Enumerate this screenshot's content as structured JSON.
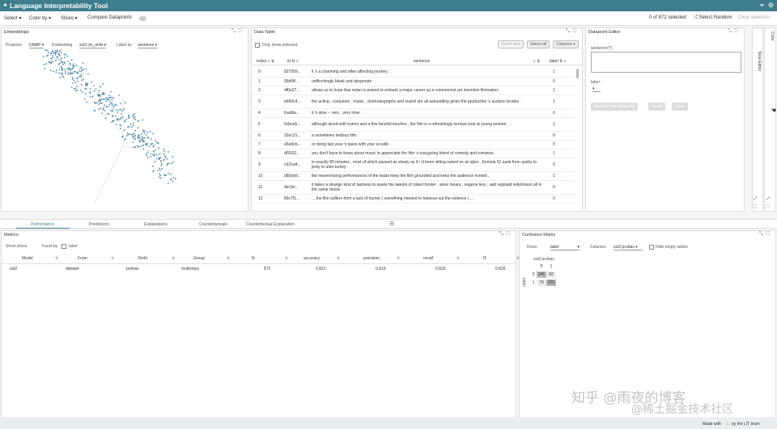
{
  "app": {
    "title": "Language Interpretability Tool"
  },
  "toolbar": {
    "select": "Select",
    "color_by": "Color by",
    "slices": "Slices",
    "compare": "Compare Datapoints",
    "selected_count": "0 of 872 selected",
    "select_random": "Select Random",
    "clear_selection": "Clear selection"
  },
  "embeddings": {
    "title": "Embeddings",
    "projector_label": "Projector",
    "projector_value": "UMAP",
    "embedding_label": "Embedding",
    "embedding_value": "sst2:cls_emb",
    "labelby_label": "Label by",
    "labelby_value": "sentence"
  },
  "datatable": {
    "title": "Data Table",
    "only_selected": "Only show selected",
    "reset_view": "Reset view",
    "select_all": "Select all",
    "columns": "Columns",
    "headers": {
      "index": "Index",
      "id": "id",
      "sentence": "sentence",
      "label": "label"
    },
    "rows": [
      {
        "index": "0",
        "id": "827559...",
        "sentence": "it 's a charming and often affecting journey .",
        "label": "1"
      },
      {
        "index": "1",
        "id": "96d0ff...",
        "sentence": "unflinchingly bleak and desperate",
        "label": "0"
      },
      {
        "index": "2",
        "id": "df0e27...",
        "sentence": "allows us to hope that nolan is poised to embark a major career as a commercial yet inventive filmmaker .",
        "label": "1"
      },
      {
        "index": "3",
        "id": "eb90c4...",
        "sentence": "the acting , costumes , music , cinematography and sound are all astounding given the production 's austere locales .",
        "label": "1"
      },
      {
        "index": "4",
        "id": "fcedba...",
        "sentence": "it 's slow -- very , very slow .",
        "label": "0"
      },
      {
        "index": "5",
        "id": "5cbca5...",
        "sentence": "although laced with humor and a few fanciful touches , the film is a refreshingly serious look at young women .",
        "label": "1"
      },
      {
        "index": "6",
        "id": "32ec21...",
        "sentence": "a sometimes tedious film .",
        "label": "0"
      },
      {
        "index": "7",
        "id": "a5a9cb...",
        "sentence": "or doing last year 's taxes with your ex-wife .",
        "label": "0"
      },
      {
        "index": "8",
        "id": "df3932...",
        "sentence": "you don't have to know about music to appreciate the film 's easygoing blend of comedy and romance .",
        "label": "1"
      },
      {
        "index": "9",
        "id": "cb31a4...",
        "sentence": "in exactly 89 minutes , most of which passed as slowly as if i 'd been sitting naked on an igloo , formula 51 sank from quirky to jerky to utter turkey .",
        "label": "0"
      },
      {
        "index": "10",
        "id": "d60a0d...",
        "sentence": "the mesmerizing performances of the leads keep the film grounded and keep the audience riveted .",
        "label": "1"
      },
      {
        "index": "11",
        "id": "dec9e...",
        "sentence": "it takes a strange kind of laziness to waste the talents of robert forster , anne meara , eugene levy , and reginald veljohnson all in the same movie .",
        "label": "0"
      },
      {
        "index": "12",
        "id": "89c7f1...",
        "sentence": "... the film suffers from a lack of humor ( something needed to balance out the violence ) ...",
        "label": "0"
      }
    ]
  },
  "datapoint_editor": {
    "title": "Datapoint Editor",
    "sentence_label": "sentence(*):",
    "label_label": "label:",
    "analyze_button": "Analyze new datapoint",
    "reset_button": "Reset",
    "clear_button": "Clear"
  },
  "side": {
    "slice_editor": "Slice Editor",
    "color": "Color"
  },
  "tabs": [
    "Performance",
    "Predictions",
    "Explanations",
    "Counterfactuals",
    "Counterfactual Explanation"
  ],
  "metrics": {
    "title": "Metrics",
    "show_slices": "Show slices",
    "facet_by": "Facet by",
    "facet_label": "label",
    "headers": [
      "Model",
      "From",
      "Field",
      "Group",
      "N",
      "accuracy",
      "precision",
      "recall",
      "f1"
    ],
    "row": [
      "sst2",
      "dataset",
      "probas",
      "multiclass",
      "872",
      "0.821",
      "0.819",
      "0.833",
      "0.826"
    ]
  },
  "confusion": {
    "title": "Confusion Matrix",
    "rows_label": "Rows",
    "rows_value": "label",
    "columns_label": "Columns",
    "columns_value": "sst2:probas",
    "hide_empty": "Hide empty labels",
    "col_title": "sst2:probas",
    "row_title": "label",
    "col_headers": [
      "0",
      "1"
    ],
    "row_headers": [
      "0",
      "1"
    ],
    "cells": [
      [
        "346",
        "82"
      ],
      [
        "74",
        "370"
      ]
    ]
  },
  "footer": {
    "made_with": "Made with",
    "by": "by the LIT team"
  },
  "watermark": {
    "text1": "知乎 @雨夜的博客",
    "text2": "@稀土掘金技术社区"
  },
  "colors": {
    "header": "#3e7d8c",
    "points": "#4f88a8"
  }
}
